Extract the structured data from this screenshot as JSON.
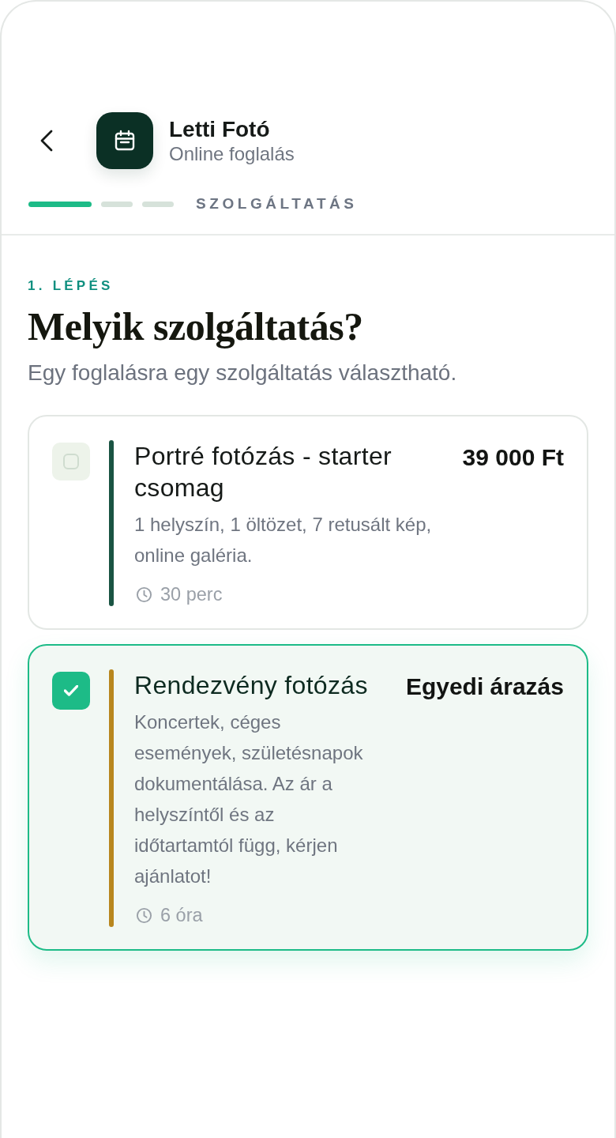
{
  "header": {
    "title": "Letti Fotó",
    "subtitle": "Online foglalás"
  },
  "progress": {
    "steps": [
      {
        "active": true
      },
      {
        "active": false
      },
      {
        "active": false
      }
    ],
    "label": "SZOLGÁLTATÁS"
  },
  "step": {
    "label": "1. LÉPÉS",
    "title": "Melyik szolgáltatás?",
    "subtitle": "Egy foglalásra egy szolgáltatás választható."
  },
  "services": [
    {
      "title": "Portré fotózás - starter csomag",
      "price": "39 000 Ft",
      "description": "1 helyszín, 1 öltözet, 7 retusált kép, online galéria.",
      "duration": "30 perc",
      "color": "#1a5443",
      "selected": false
    },
    {
      "title": "Rendezvény fotózás",
      "price": "Egyedi árazás",
      "description": "Koncertek, céges események, születésnapok dokumentálása. Az ár a helyszíntől és az időtartamtól függ, kérjen ajánlatot!",
      "duration": "6 óra",
      "color": "#b8861e",
      "selected": true
    }
  ]
}
